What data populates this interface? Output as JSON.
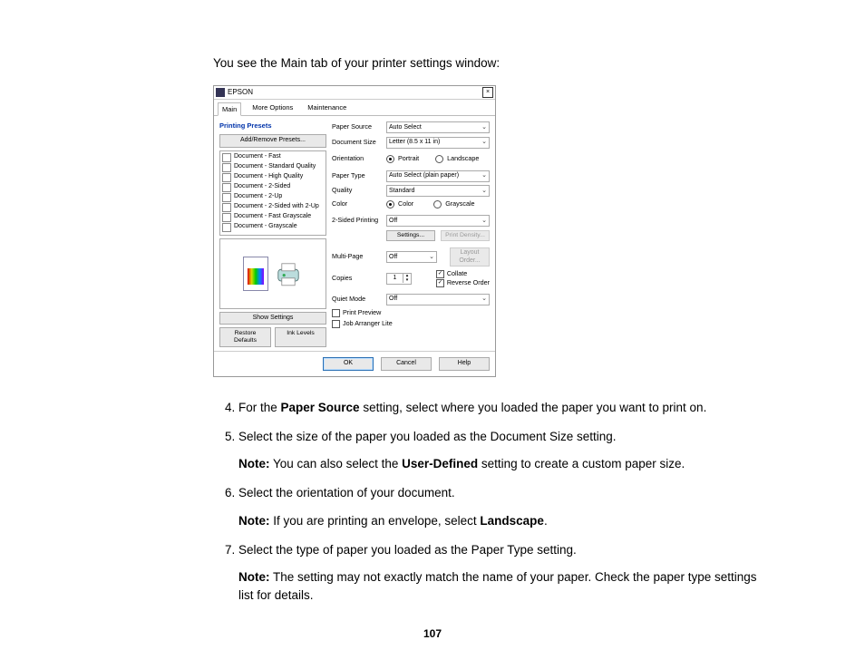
{
  "intro_text": "You see the Main tab of your printer settings window:",
  "dialog": {
    "title": "EPSON",
    "tabs": [
      "Main",
      "More Options",
      "Maintenance"
    ],
    "presets_header": "Printing Presets",
    "add_remove_btn": "Add/Remove Presets...",
    "presets": [
      "Document - Fast",
      "Document - Standard Quality",
      "Document - High Quality",
      "Document - 2-Sided",
      "Document - 2-Up",
      "Document - 2-Sided with 2-Up",
      "Document - Fast Grayscale",
      "Document - Grayscale"
    ],
    "show_settings_btn": "Show Settings",
    "restore_defaults_btn": "Restore Defaults",
    "ink_levels_btn": "Ink Levels",
    "labels": {
      "paper_source": "Paper Source",
      "document_size": "Document Size",
      "orientation": "Orientation",
      "portrait": "Portrait",
      "landscape": "Landscape",
      "paper_type": "Paper Type",
      "quality": "Quality",
      "color": "Color",
      "color_opt": "Color",
      "grayscale_opt": "Grayscale",
      "two_sided": "2-Sided Printing",
      "settings_btn": "Settings...",
      "density_btn": "Print Density...",
      "multi_page": "Multi-Page",
      "layout_order_btn": "Layout Order...",
      "copies": "Copies",
      "collate": "Collate",
      "reverse_order": "Reverse Order",
      "quiet_mode": "Quiet Mode",
      "print_preview": "Print Preview",
      "job_arranger": "Job Arranger Lite"
    },
    "values": {
      "paper_source": "Auto Select",
      "document_size": "Letter (8.5 x 11 in)",
      "paper_type": "Auto Select (plain paper)",
      "quality": "Standard",
      "two_sided": "Off",
      "multi_page": "Off",
      "copies": "1",
      "quiet_mode": "Off"
    },
    "footer": {
      "ok": "OK",
      "cancel": "Cancel",
      "help": "Help"
    }
  },
  "steps": {
    "s4": {
      "pre": "For the ",
      "bold": "Paper Source",
      "post": " setting, select where you loaded the paper you want to print on."
    },
    "s5": {
      "text": "Select the size of the paper you loaded as the Document Size setting.",
      "note_pre": "Note:",
      "note_mid": " You can also select the ",
      "note_bold": "User-Defined",
      "note_post": " setting to create a custom paper size."
    },
    "s6": {
      "text": "Select the orientation of your document.",
      "note_pre": "Note:",
      "note_mid": " If you are printing an envelope, select ",
      "note_bold": "Landscape",
      "note_post": "."
    },
    "s7": {
      "text": "Select the type of paper you loaded as the Paper Type setting.",
      "note_pre": "Note:",
      "note_post": " The setting may not exactly match the name of your paper. Check the paper type settings list for details."
    }
  },
  "page_number": "107"
}
